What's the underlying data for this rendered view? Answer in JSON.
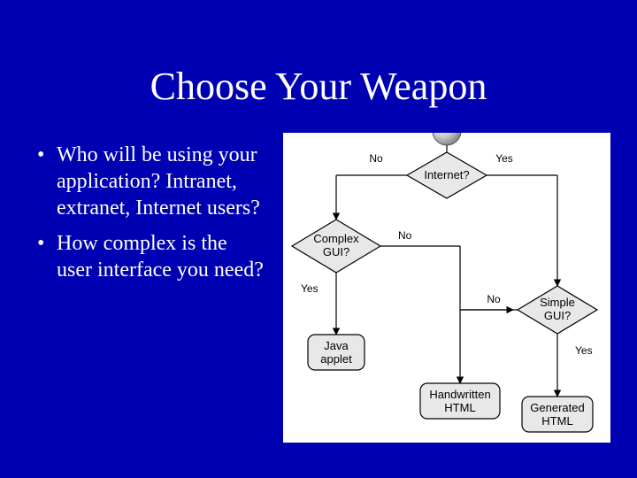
{
  "title": "Choose Your Weapon",
  "bullets": [
    "Who will be using your application? Intranet, extranet, Internet users?",
    "How complex is the user interface you need?"
  ],
  "flow": {
    "nodes": {
      "internet": "Internet?",
      "complex_gui_l1": "Complex",
      "complex_gui_l2": "GUI?",
      "simple_gui_l1": "Simple",
      "simple_gui_l2": "GUI?",
      "java_applet_l1": "Java",
      "java_applet_l2": "applet",
      "handwritten_l1": "Handwritten",
      "handwritten_l2": "HTML",
      "generated_l1": "Generated",
      "generated_l2": "HTML"
    },
    "edges": {
      "no": "No",
      "yes": "Yes"
    }
  }
}
